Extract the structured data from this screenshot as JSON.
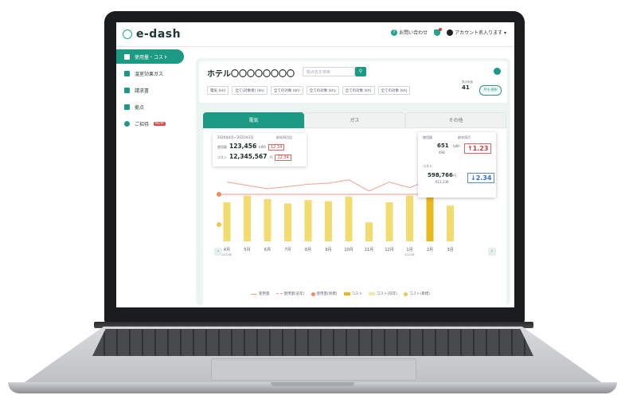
{
  "app": {
    "logo": "e-dash",
    "header": {
      "help": "お問い合わせ",
      "account": "アカウント名入ります ▾"
    }
  },
  "sidebar": {
    "items": [
      {
        "label": "使用量・コスト",
        "active": true
      },
      {
        "label": "温室効果ガス"
      },
      {
        "label": "請求書"
      },
      {
        "label": "拠点"
      },
      {
        "label": "ご招待",
        "badge": "NEW"
      }
    ]
  },
  "filters": {
    "hotel_name": "ホテル〇〇〇〇〇〇〇〇",
    "search_placeholder": "拠点名を検索",
    "selects": [
      "電気 (kh)",
      "全て(対象者) (kh)",
      "全ての対象 (kh)",
      "全ての対象 (kh)",
      "全ての対象 (kh)",
      "全ての対象 (kh)"
    ],
    "year_label": "表示年度",
    "year": "41",
    "confirm": "月を選択"
  },
  "tabs": [
    "電気",
    "ガス",
    "その他"
  ],
  "summary": {
    "period": "2020年4月〜2021年3月",
    "unit": "前年同月比",
    "usage_label": "使用量",
    "usage_value": "123,456",
    "usage_unit": "kWh",
    "usage_pct": "12.34",
    "cost_label": "コスト",
    "cost_value": "12,345,567",
    "cost_unit": "円",
    "cost_pct": "12.34"
  },
  "tooltip": {
    "usage_label": "使用量",
    "usage_value": "651",
    "usage_prev": "498",
    "usage_unit": "kWh",
    "usage_pct": "↑1.23",
    "cost_label": "コスト",
    "cost_value": "598,766",
    "cost_prev": "612,336",
    "cost_unit": "円",
    "cost_pct": "↓2.34",
    "prev_label": "前年同月"
  },
  "legend": [
    "使用量",
    "使用量(前年)",
    "使用量(目標)",
    "コスト",
    "コスト(前年)",
    "コスト(目標)"
  ],
  "colors": {
    "accent": "#1c9a83",
    "bar": "#f2dc70",
    "bar_highlight": "#e9b81f",
    "line_usage": "#f0a090",
    "line_cost": "#ecc94b"
  },
  "chart_data": {
    "type": "bar",
    "categories": [
      "4月",
      "5月",
      "6月",
      "7月",
      "8月",
      "9月",
      "10月",
      "11月",
      "12月",
      "1月",
      "2月",
      "3月"
    ],
    "series": [
      {
        "name": "コスト",
        "values": [
          70,
          82,
          76,
          68,
          74,
          72,
          80,
          34,
          70,
          82,
          98,
          64
        ]
      },
      {
        "name": "使用量",
        "values": [
          92,
          86,
          80,
          84,
          88,
          90,
          96,
          76,
          92,
          82,
          96,
          90
        ]
      }
    ],
    "highlight_index": 10,
    "x_sublabels": [
      "2020年",
      "",
      "",
      "",
      "",
      "",
      "",
      "",
      "",
      "2021年",
      "",
      ""
    ]
  }
}
